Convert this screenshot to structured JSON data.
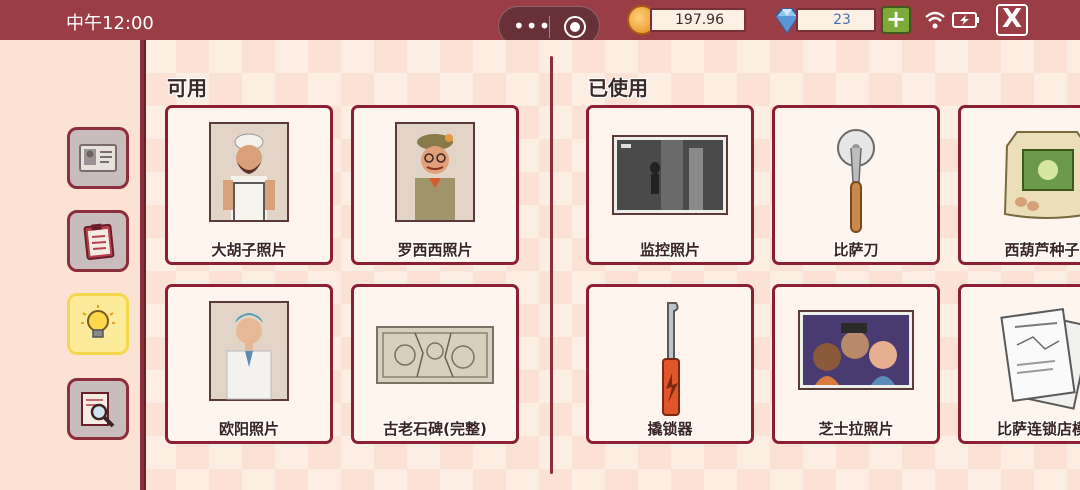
{
  "status_bar": {
    "time": "中午12:00"
  },
  "currency": {
    "coins": "197.96",
    "gems": "23",
    "plus_label": "+",
    "close_label": "X"
  },
  "sidebar": {
    "items": [
      {
        "name": "id-card"
      },
      {
        "name": "clipboard"
      },
      {
        "name": "lightbulb",
        "active": true
      },
      {
        "name": "magnifier-notebook"
      }
    ]
  },
  "sections": {
    "available": {
      "title": "可用",
      "items": [
        {
          "label": "大胡子照片"
        },
        {
          "label": "罗西西照片"
        },
        {
          "label": "欧阳照片"
        },
        {
          "label": "古老石碑(完整)"
        }
      ]
    },
    "used": {
      "title": "已使用",
      "items": [
        {
          "label": "监控照片"
        },
        {
          "label": "比萨刀"
        },
        {
          "label": "西葫芦种子"
        },
        {
          "label": "撬锁器"
        },
        {
          "label": "芝士拉照片"
        },
        {
          "label": "比萨连锁店模"
        }
      ]
    }
  },
  "colors": {
    "top_bar": "#9b3d44",
    "card_border": "#8c1f34",
    "active_tab": "#fbeb9b"
  }
}
